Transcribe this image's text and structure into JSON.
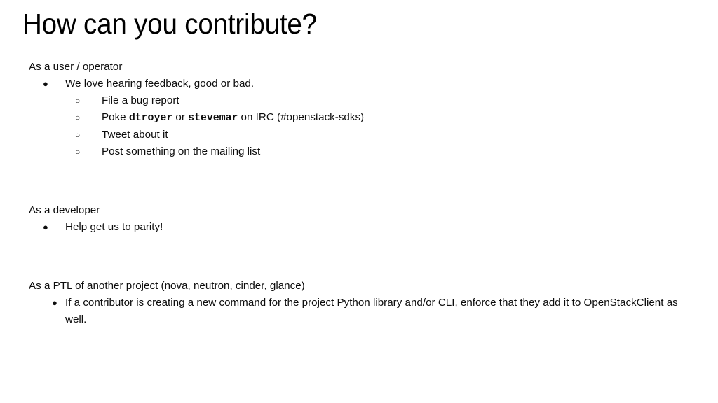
{
  "slide": {
    "title": "How can you contribute?",
    "background_color": "#ffffff",
    "text_color": "#0d0d0d",
    "markers": {
      "level1": "●",
      "level2": "○"
    },
    "sections": [
      {
        "heading": "As a user / operator",
        "bullets": [
          {
            "level": 1,
            "text": "We love hearing feedback, good or bad."
          },
          {
            "level": 2,
            "text": "File a bug report"
          },
          {
            "level": 2,
            "parts": [
              {
                "kind": "plain",
                "text": "Poke "
              },
              {
                "kind": "mono",
                "text": "dtroyer"
              },
              {
                "kind": "plain",
                "text": " or "
              },
              {
                "kind": "mono",
                "text": "stevemar"
              },
              {
                "kind": "plain",
                "text": " on IRC (#openstack-sdks)"
              }
            ],
            "text": "Poke dtroyer or stevemar on IRC (#openstack-sdks)"
          },
          {
            "level": 2,
            "text": "Tweet about it"
          },
          {
            "level": 2,
            "text": "Post something on the mailing list"
          }
        ]
      },
      {
        "heading": "As a developer",
        "bullets": [
          {
            "level": 1,
            "text": "Help get us to parity!"
          }
        ]
      },
      {
        "heading": "As a PTL of another project (nova, neutron, cinder, glance)",
        "bullets": [
          {
            "level": 1,
            "text": "If a contributor is creating a new command for the project Python library and/or CLI, enforce that they add it to OpenStackClient as well."
          }
        ]
      }
    ]
  }
}
